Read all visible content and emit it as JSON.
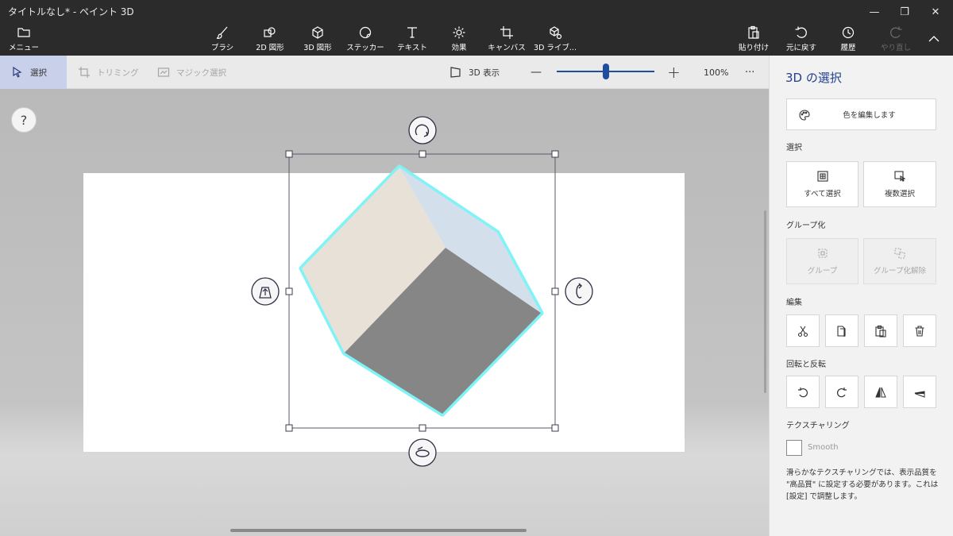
{
  "window": {
    "title": "タイトルなし* - ペイント 3D",
    "minimize": "—",
    "maximize": "❐",
    "close": "✕"
  },
  "toolbar": {
    "menu": "メニュー",
    "brush": "ブラシ",
    "shapes2d": "2D 図形",
    "shapes3d": "3D 図形",
    "sticker": "ステッカー",
    "text": "テキスト",
    "effects": "効果",
    "canvas": "キャンバス",
    "library3d": "3D ライブ...",
    "paste": "貼り付け",
    "undo": "元に戻す",
    "history": "履歴",
    "redo": "やり直し"
  },
  "subbar": {
    "select": "選択",
    "trim": "トリミング",
    "magic_select": "マジック選択",
    "view3d": "3D 表示",
    "zoom_minus": "—",
    "zoom_plus": "+",
    "zoom_level": "100%",
    "zoom_fraction": 0.5,
    "more": "···"
  },
  "canvas": {
    "help": "?"
  },
  "panel": {
    "title": "3D の選択",
    "edit_color": "色を編集します",
    "section_select": "選択",
    "select_all": "すべて選択",
    "multi_select": "複数選択",
    "section_group": "グループ化",
    "group": "グループ",
    "ungroup": "グループ化解除",
    "section_edit": "編集",
    "section_rotate": "回転と反転",
    "section_texture": "テクスチャリング",
    "smooth": "Smooth",
    "note": "滑らかなテクスチャリングでは、表示品質を \"高品質\" に設定する必要があります。これは [設定] で調整します。"
  },
  "colors": {
    "accent": "#1f4e9e",
    "titlebar": "#2b2b2b",
    "selection_glow": "#7ff3f5"
  }
}
